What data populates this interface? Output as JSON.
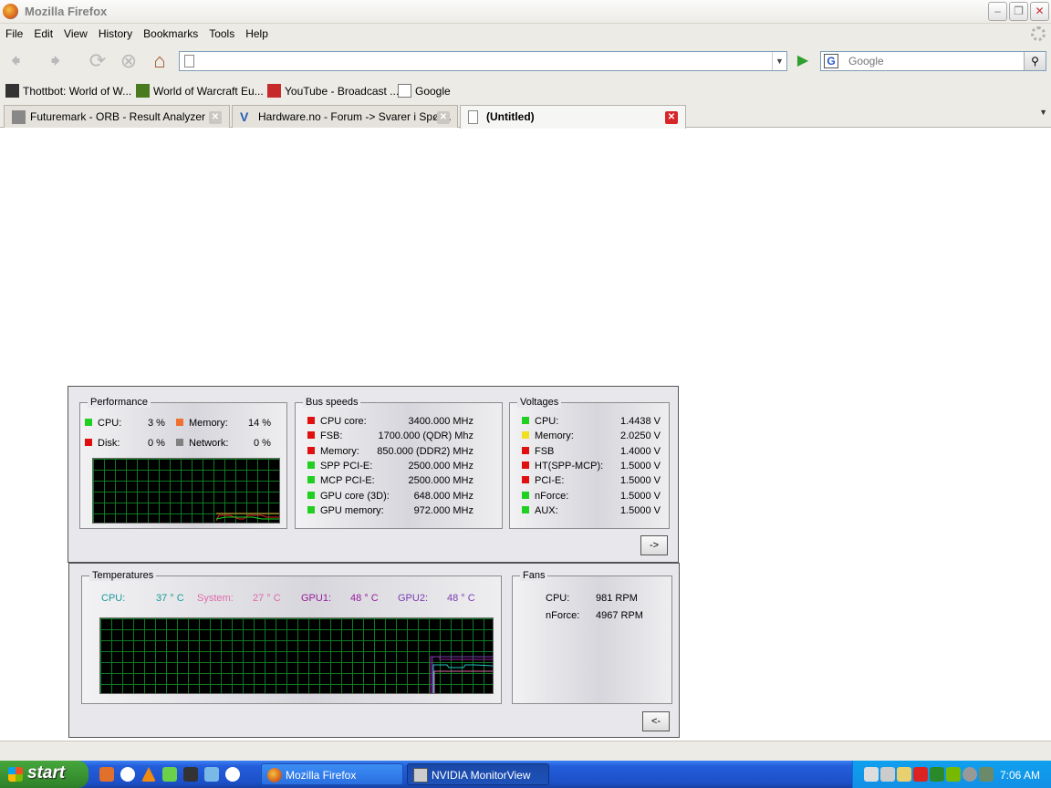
{
  "window": {
    "title": "Mozilla Firefox"
  },
  "menu": [
    "File",
    "Edit",
    "View",
    "History",
    "Bookmarks",
    "Tools",
    "Help"
  ],
  "search": {
    "placeholder": "Google"
  },
  "bookmarks": [
    "Thottbot: World of W...",
    "World of Warcraft Eu...",
    "YouTube - Broadcast ...",
    "Google"
  ],
  "tabs": [
    {
      "label": "Futuremark - ORB - Result Analyzer",
      "active": false
    },
    {
      "label": "Hardware.no - Forum -> Svarer i Spør...",
      "active": false
    },
    {
      "label": "(Untitled)",
      "active": true
    }
  ],
  "monitor": {
    "performance": {
      "title": "Performance",
      "cpu_label": "CPU:",
      "cpu_value": "3 %",
      "memory_label": "Memory:",
      "memory_value": "14 %",
      "disk_label": "Disk:",
      "disk_value": "0 %",
      "network_label": "Network:",
      "network_value": "0 %"
    },
    "bus": {
      "title": "Bus speeds",
      "rows": [
        {
          "label": "CPU core:",
          "value": "3400.000 MHz",
          "color": "#e01010"
        },
        {
          "label": "FSB:",
          "value": "1700.000 (QDR) Mhz",
          "color": "#e01010"
        },
        {
          "label": "Memory:",
          "value": "850.000  (DDR2) MHz",
          "color": "#e01010"
        },
        {
          "label": "SPP PCI-E:",
          "value": "2500.000 MHz",
          "color": "#20d020"
        },
        {
          "label": "MCP PCI-E:",
          "value": "2500.000 MHz",
          "color": "#20d020"
        },
        {
          "label": "GPU core (3D):",
          "value": "648.000 MHz",
          "color": "#20d020"
        },
        {
          "label": "GPU memory:",
          "value": "972.000 MHz",
          "color": "#20d020"
        }
      ]
    },
    "voltages": {
      "title": "Voltages",
      "rows": [
        {
          "label": "CPU:",
          "value": "1.4438 V",
          "color": "#20d020"
        },
        {
          "label": "Memory:",
          "value": "2.0250 V",
          "color": "#f0e020"
        },
        {
          "label": "FSB",
          "value": "1.4000 V",
          "color": "#e01010"
        },
        {
          "label": "HT(SPP-MCP):",
          "value": "1.5000 V",
          "color": "#e01010"
        },
        {
          "label": "PCI-E:",
          "value": "1.5000 V",
          "color": "#e01010"
        },
        {
          "label": "nForce:",
          "value": "1.5000 V",
          "color": "#20d020"
        },
        {
          "label": "AUX:",
          "value": "1.5000 V",
          "color": "#20d020"
        }
      ]
    },
    "next_button": "->",
    "temperatures": {
      "title": "Temperatures",
      "cpu_label": "CPU:",
      "cpu_value": "37 ° C",
      "system_label": "System:",
      "system_value": "27 ° C",
      "gpu1_label": "GPU1:",
      "gpu1_value": "48 ° C",
      "gpu2_label": "GPU2:",
      "gpu2_value": "48 ° C"
    },
    "fans": {
      "title": "Fans",
      "cpu_label": "CPU:",
      "cpu_value": "981 RPM",
      "nforce_label": "nForce:",
      "nforce_value": "4967 RPM"
    },
    "back_button": "<-"
  },
  "taskbar": {
    "start": "start",
    "buttons": [
      {
        "label": "Mozilla Firefox"
      },
      {
        "label": "NVIDIA MonitorView"
      }
    ],
    "clock": "7:06 AM"
  }
}
